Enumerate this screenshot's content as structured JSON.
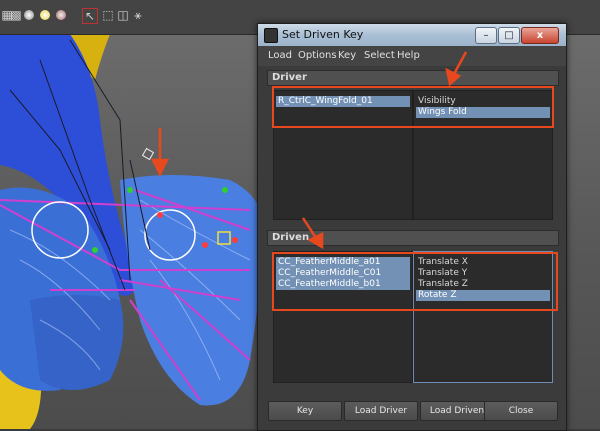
{
  "dialog": {
    "title": "Set Driven Key",
    "window_controls": {
      "minimize": "–",
      "maximize": "□",
      "close": "x"
    }
  },
  "menubar": [
    "Load",
    "Options",
    "Key",
    "Select",
    "Help"
  ],
  "driver": {
    "header": "Driver",
    "objects": [
      "R_CtrlC_WingFold_01"
    ],
    "attributes": [
      "Visibility",
      "Wings Fold"
    ],
    "selected_object": "R_CtrlC_WingFold_01",
    "selected_attribute": "Wings Fold"
  },
  "driven": {
    "header": "Driven",
    "objects": [
      "CC_FeatherMiddle_a01",
      "CC_FeatherMiddle_C01",
      "CC_FeatherMiddle_b01"
    ],
    "attributes": [
      "Translate X",
      "Translate Y",
      "Translate Z",
      "Rotate Z"
    ],
    "selected_attribute": "Rotate Z"
  },
  "buttons": [
    "Key",
    "Load Driver",
    "Load Driven",
    "Close"
  ],
  "colors": {
    "highlight_box": "#e8481d",
    "selection": "#7391b5",
    "titlebar": "#a9bfd4",
    "feathers": "#3a6fd6",
    "rig_curves": "#d040d0"
  },
  "viewport_icons": [
    "grid-icon",
    "shade-ball-icon",
    "light-ball-icon",
    "texture-ball-icon",
    "select-icon",
    "cube-icon",
    "cube-outline-icon",
    "graph-icon"
  ]
}
